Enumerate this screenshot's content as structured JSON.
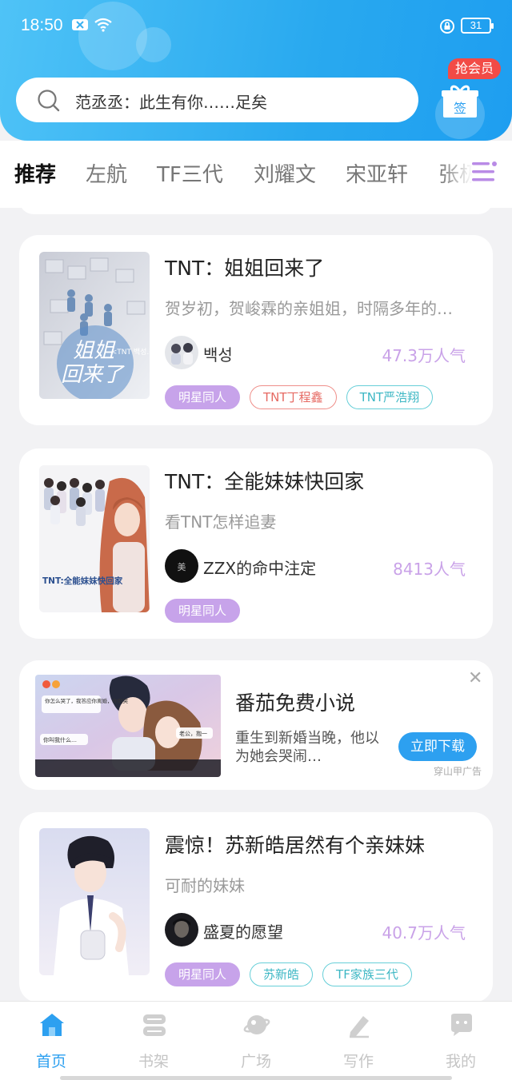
{
  "status_bar": {
    "time": "18:50",
    "battery": "31"
  },
  "search": {
    "text": "范丞丞：此生有你……足矣"
  },
  "vip": {
    "badge": "抢会员",
    "gift_label": "签"
  },
  "tabs": [
    {
      "label": "推荐"
    },
    {
      "label": "左航"
    },
    {
      "label": "TF三代"
    },
    {
      "label": "刘耀文"
    },
    {
      "label": "宋亚轩"
    },
    {
      "label": "张极"
    }
  ],
  "books": [
    {
      "title": "TNT：姐姐回来了",
      "desc": "贺岁初，贺峻霖的亲姐姐，时隔多年的…",
      "author": "백성",
      "popularity": "47.3万人气",
      "cover_text": "姐姐回来了",
      "cover_sub": "<TNT 백성.著",
      "tags": [
        {
          "label": "明星同人",
          "style": "filled"
        },
        {
          "label": "TNT丁程鑫",
          "style": "red"
        },
        {
          "label": "TNT严浩翔",
          "style": "teal"
        }
      ]
    },
    {
      "title": "TNT：全能妹妹快回家",
      "desc": "看TNT怎样追妻",
      "author": "ZZX的命中注定",
      "popularity": "8413人气",
      "cover_text": "TNT:全能妹妹快回家",
      "tags": [
        {
          "label": "明星同人",
          "style": "filled"
        }
      ]
    },
    {
      "title": "震惊！苏新皓居然有个亲妹妹",
      "desc": "可耐的妹妹",
      "author": "盛夏的愿望",
      "popularity": "40.7万人气",
      "tags": [
        {
          "label": "明星同人",
          "style": "filled"
        },
        {
          "label": "苏新皓",
          "style": "teal"
        },
        {
          "label": "TF家族三代",
          "style": "teal"
        }
      ]
    }
  ],
  "ad": {
    "title": "番茄免费小说",
    "desc": "重生到新婚当晚，他以为她会哭闹…",
    "button": "立即下载",
    "source": "穿山甲广告",
    "close": "✕",
    "bubble_1": "你怎么哭了，我答应你离婚，你别哭",
    "bubble_2": "老公，抱一",
    "bubble_3": "你叫我什么…"
  },
  "bottom_nav": [
    {
      "label": "首页",
      "active": true
    },
    {
      "label": "书架",
      "active": false
    },
    {
      "label": "广场",
      "active": false
    },
    {
      "label": "写作",
      "active": false
    },
    {
      "label": "我的",
      "active": false
    }
  ],
  "colors": {
    "header_blue": "#29a9ef",
    "accent_purple": "#c7a3ea",
    "nav_active": "#2da0f0",
    "vip_red": "#f24b46"
  }
}
